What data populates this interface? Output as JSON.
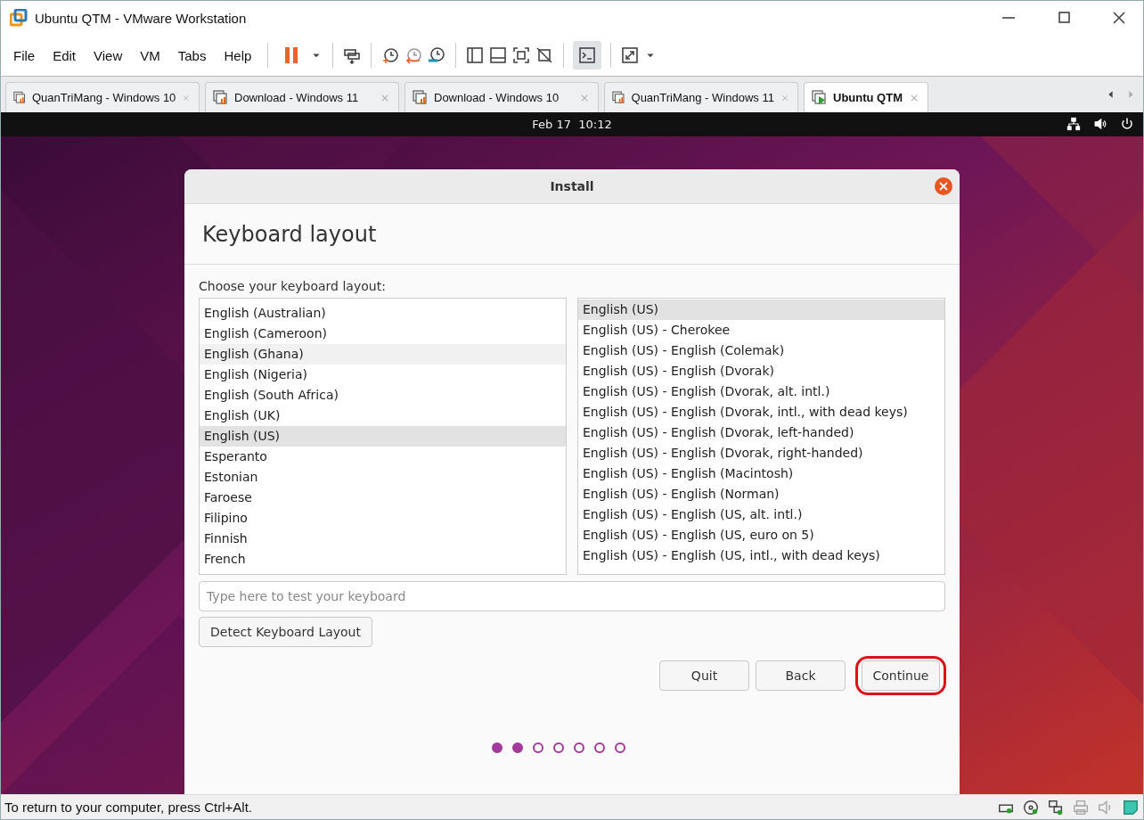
{
  "window": {
    "title": "Ubuntu QTM - VMware Workstation"
  },
  "menu": [
    "File",
    "Edit",
    "View",
    "VM",
    "Tabs",
    "Help"
  ],
  "tabs": [
    {
      "label": "QuanTriMang - Windows 10",
      "selected": false,
      "running": false
    },
    {
      "label": "Download - Windows 11",
      "selected": false,
      "running": false
    },
    {
      "label": "Download - Windows 10",
      "selected": false,
      "running": false
    },
    {
      "label": "QuanTriMang - Windows 11",
      "selected": false,
      "running": false
    },
    {
      "label": "Ubuntu QTM",
      "selected": true,
      "running": true
    }
  ],
  "guest_top_bar": {
    "clock": "Feb 17  10:12"
  },
  "dialog": {
    "title": "Install",
    "heading": "Keyboard layout",
    "prompt": "Choose your keyboard layout:",
    "layouts": [
      {
        "label": "English (Australian)",
        "selected": false,
        "hovered": false
      },
      {
        "label": "English (Cameroon)",
        "selected": false,
        "hovered": false
      },
      {
        "label": "English (Ghana)",
        "selected": false,
        "hovered": true
      },
      {
        "label": "English (Nigeria)",
        "selected": false,
        "hovered": false
      },
      {
        "label": "English (South Africa)",
        "selected": false,
        "hovered": false
      },
      {
        "label": "English (UK)",
        "selected": false,
        "hovered": false
      },
      {
        "label": "English (US)",
        "selected": true,
        "hovered": false
      },
      {
        "label": "Esperanto",
        "selected": false,
        "hovered": false
      },
      {
        "label": "Estonian",
        "selected": false,
        "hovered": false
      },
      {
        "label": "Faroese",
        "selected": false,
        "hovered": false
      },
      {
        "label": "Filipino",
        "selected": false,
        "hovered": false
      },
      {
        "label": "Finnish",
        "selected": false,
        "hovered": false
      },
      {
        "label": "French",
        "selected": false,
        "hovered": false
      }
    ],
    "variants": [
      {
        "label": "English (US)",
        "selected": true
      },
      {
        "label": "English (US) - Cherokee",
        "selected": false
      },
      {
        "label": "English (US) - English (Colemak)",
        "selected": false
      },
      {
        "label": "English (US) - English (Dvorak)",
        "selected": false
      },
      {
        "label": "English (US) - English (Dvorak, alt. intl.)",
        "selected": false
      },
      {
        "label": "English (US) - English (Dvorak, intl., with dead keys)",
        "selected": false
      },
      {
        "label": "English (US) - English (Dvorak, left-handed)",
        "selected": false
      },
      {
        "label": "English (US) - English (Dvorak, right-handed)",
        "selected": false
      },
      {
        "label": "English (US) - English (Macintosh)",
        "selected": false
      },
      {
        "label": "English (US) - English (Norman)",
        "selected": false
      },
      {
        "label": "English (US) - English (US, alt. intl.)",
        "selected": false
      },
      {
        "label": "English (US) - English (US, euro on 5)",
        "selected": false
      },
      {
        "label": "English (US) - English (US, intl., with dead keys)",
        "selected": false
      }
    ],
    "test_field": {
      "placeholder": "Type here to test your keyboard"
    },
    "detect_button": "Detect Keyboard Layout",
    "buttons": [
      {
        "label": "Quit",
        "highlighted": false
      },
      {
        "label": "Back",
        "highlighted": false
      },
      {
        "label": "Continue",
        "highlighted": true
      }
    ],
    "steps": [
      {
        "filled": true
      },
      {
        "filled": true
      },
      {
        "filled": false
      },
      {
        "filled": false
      },
      {
        "filled": false
      },
      {
        "filled": false
      },
      {
        "filled": false
      }
    ]
  },
  "status_bar": {
    "message": "To return to your computer, press Ctrl+Alt."
  }
}
